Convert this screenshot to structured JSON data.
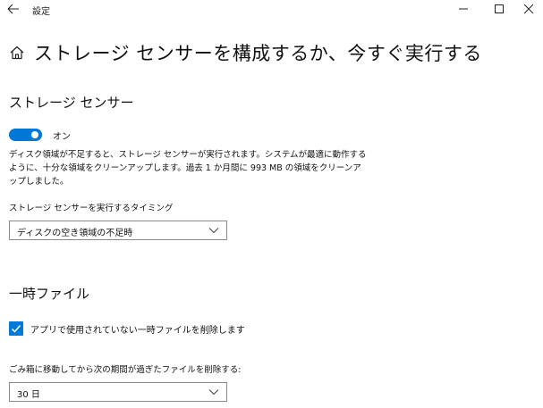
{
  "titlebar": {
    "app_title": "設定",
    "back_icon": "back-arrow-icon",
    "minimize_icon": "minimize-icon",
    "maximize_icon": "maximize-icon",
    "close_icon": "close-icon"
  },
  "page": {
    "title": "ストレージ センサーを構成するか、今すぐ実行する",
    "title_icon": "home-icon"
  },
  "storage_sense": {
    "heading": "ストレージ センサー",
    "toggle_state_label": "オン",
    "toggle_on": true,
    "description": "ディスク領域が不足すると、ストレージ センサーが実行されます。システムが最適に動作するように、十分な領域をクリーンアップします。過去 1 か月間に 993 MB の領域をクリーンアップしました。",
    "run_timing_label": "ストレージ センサーを実行するタイミング",
    "run_timing_value": "ディスクの空き領域の不足時"
  },
  "temp_files": {
    "heading": "一時ファイル",
    "delete_unused_temp_label": "アプリで使用されていない一時ファイルを削除します",
    "delete_unused_temp_checked": true,
    "recycle_bin_label": "ごみ箱に移動してから次の期間が過ぎたファイルを削除する:",
    "recycle_bin_value": "30 日"
  },
  "colors": {
    "accent": "#0078d7",
    "text": "#111111",
    "background": "#ffffff"
  }
}
